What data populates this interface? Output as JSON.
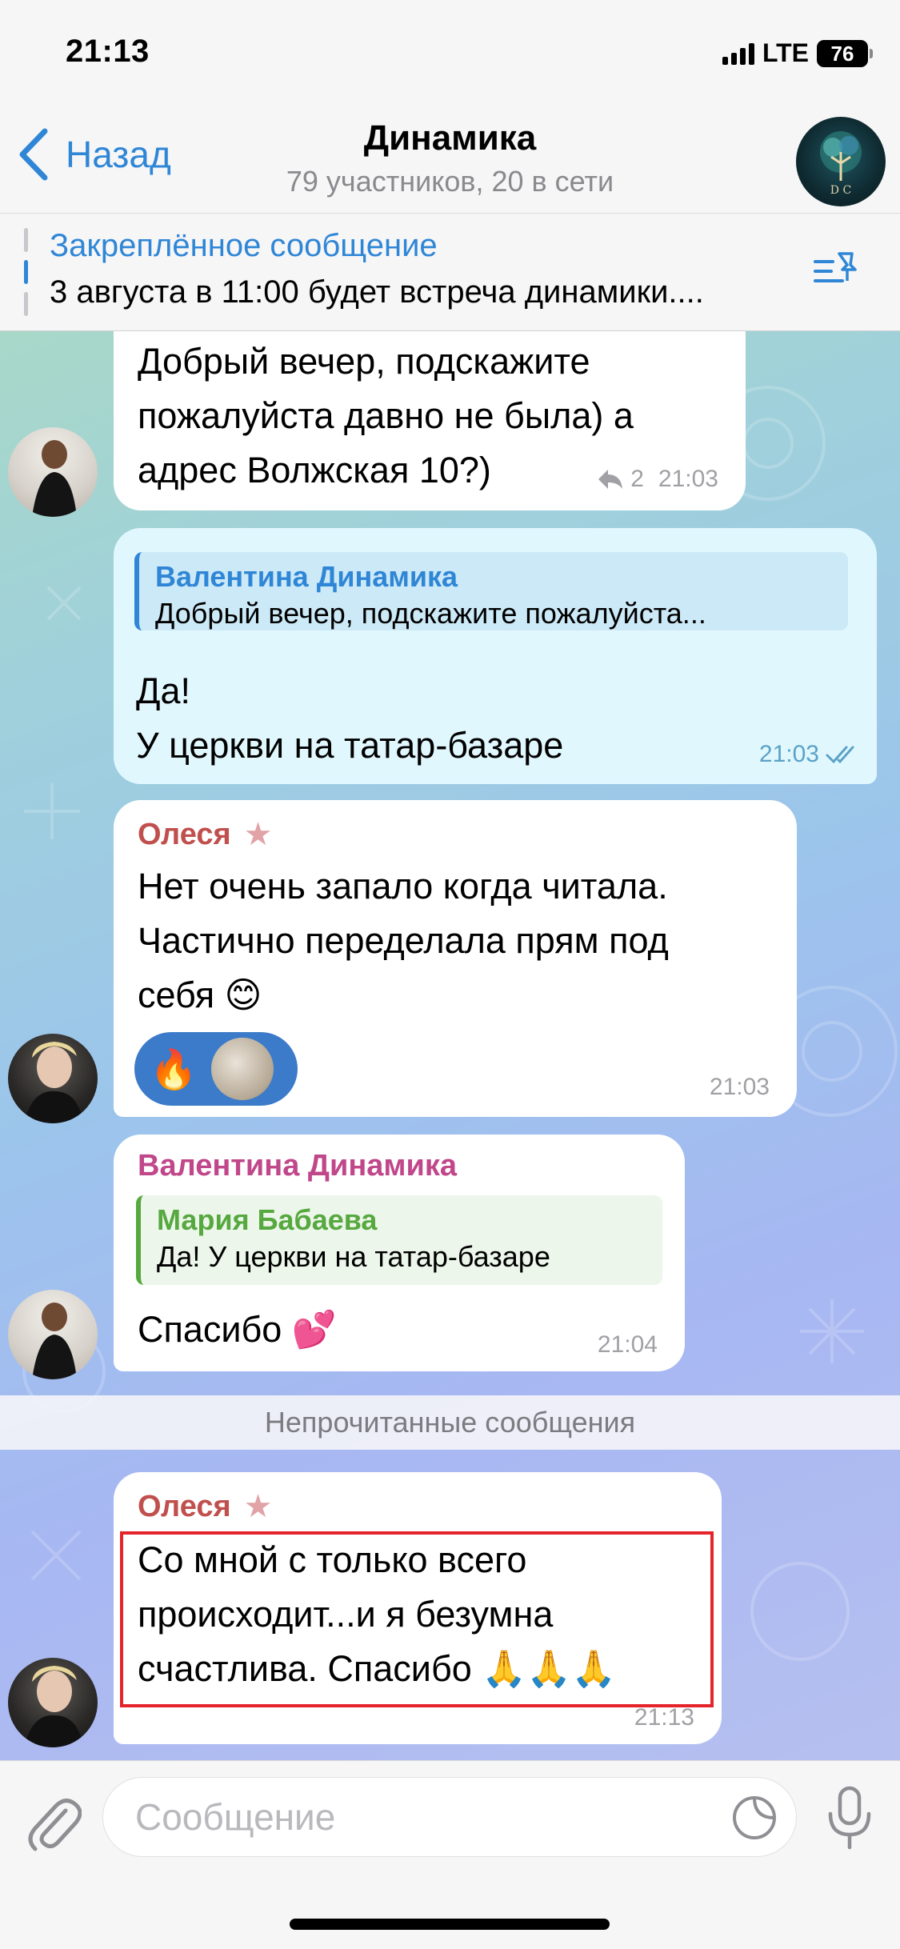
{
  "status_bar": {
    "time": "21:13",
    "network": "LTE",
    "battery": "76"
  },
  "header": {
    "back_label": "Назад",
    "title": "Динамика",
    "subtitle": "79 участников, 20 в сети",
    "avatar_icon": "group-logo-icon"
  },
  "pinned": {
    "title": "Закреплённое сообщение",
    "text": "3 августа в 11:00 будет встреча динамики...."
  },
  "messages": [
    {
      "text": "Добрый вечер, подскажите\nпожалуйста  давно не была) а\nадрес Волжская 10?)",
      "replies_count": "2",
      "time": "21:03"
    },
    {
      "reply_name": "Валентина Динамика",
      "reply_text": "Добрый вечер, подскажите пожалуйста...",
      "text": "Да!\nУ церкви на татар-базаре",
      "time": "21:03"
    },
    {
      "sender": "Олеся",
      "text": "Нет очень запало когда читала.\n Частично переделала прям  под\nсебя 😊",
      "reaction": "🔥",
      "time": "21:03"
    },
    {
      "sender": "Валентина Динамика",
      "reply_name": "Мария Бабаева",
      "reply_text": "Да! У церкви на татар-базаре",
      "text": "Спасибо 💕",
      "time": "21:04"
    },
    {
      "sender": "Олеся",
      "text": "Со мной с только всего\nпроисходит...и я безумна\nсчастлива. Спасибо 🙏🙏🙏",
      "time": "21:13"
    }
  ],
  "unread_label": "Непрочитанные сообщения",
  "composer": {
    "placeholder": "Сообщение"
  },
  "colors": {
    "accent": "#2f86d6",
    "olesya_name": "#c0504d",
    "valentina_name": "#c0478a",
    "highlight": "#e4232b"
  }
}
